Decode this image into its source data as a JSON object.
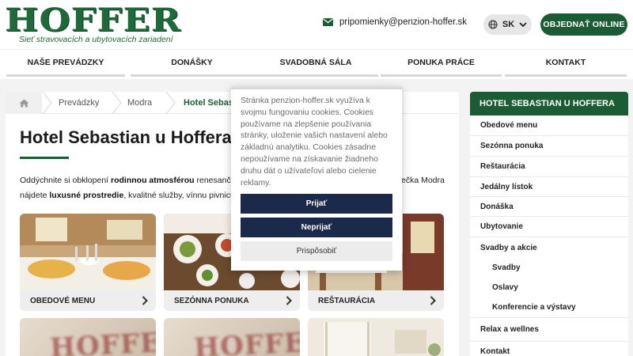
{
  "header": {
    "logo_text": "HOFFER",
    "logo_tagline": "Sieť stravovacích a ubytovacích zariadení",
    "email": "pripomienky@penzion-hoffer.sk",
    "language": "SK",
    "order_button": "OBJEDNAŤ ONLINE",
    "brand_color": "#1c5c35"
  },
  "nav": {
    "items": [
      {
        "label": "NAŠE PREVÁDZKY"
      },
      {
        "label": "DONÁŠKY"
      },
      {
        "label": "SVADOBNÁ SÁLA"
      },
      {
        "label": "PONUKA PRÁCE"
      },
      {
        "label": "KONTAKT"
      }
    ]
  },
  "breadcrumb": {
    "items": [
      "Prevádzky",
      "Modra",
      "Hotel Sebastian u Hoffera"
    ]
  },
  "main": {
    "title": "Hotel Sebastian u Hoffera",
    "intro_line1_a": "Oddýchnite si obklopení ",
    "intro_line1_b": "rodinnou atmosférou",
    "intro_line1_c": " renesančného do",
    "intro_line1_d": "ečka Modra",
    "intro_line2_a": "nájdete ",
    "intro_line2_b": "luxusné prostredie",
    "intro_line2_c": ", kvalitné služby, vínnu pivnicu, výbor",
    "tiles": [
      {
        "label": "OBEDOVÉ MENU"
      },
      {
        "label": "SEZÓNNA PONUKA"
      },
      {
        "label": "REŠTAURÁCIA"
      }
    ],
    "tile_watermark": "HOFFER"
  },
  "sidebar": {
    "heading": "HOTEL SEBASTIAN U HOFFERA",
    "items": [
      {
        "label": "Obedové menu"
      },
      {
        "label": "Sezónna ponuka"
      },
      {
        "label": "Reštaurácia"
      },
      {
        "label": "Jedálny lístok"
      },
      {
        "label": "Donáška"
      },
      {
        "label": "Ubytovanie"
      },
      {
        "label": "Svadby a akcie"
      },
      {
        "label": "Svadby"
      },
      {
        "label": "Oslavy"
      },
      {
        "label": "Konferencie a výstavy"
      },
      {
        "label": "Relax a wellnes"
      },
      {
        "label": "Kontakt"
      }
    ]
  },
  "cookie": {
    "text": "Stránka penzion-hoffer.sk využíva k svojmu fungovaniu cookies. Cookies používame na zlepšenie používania stránky, uloženie vašich nastavení alebo základnú analytiku. Cookies zásadne nepoužívame na získavanie žiadneho druhu dát o užívateľovi alebo cielenie reklamy.",
    "accept": "Prijať",
    "reject": "Neprijať",
    "customize": "Prispôsobiť"
  }
}
